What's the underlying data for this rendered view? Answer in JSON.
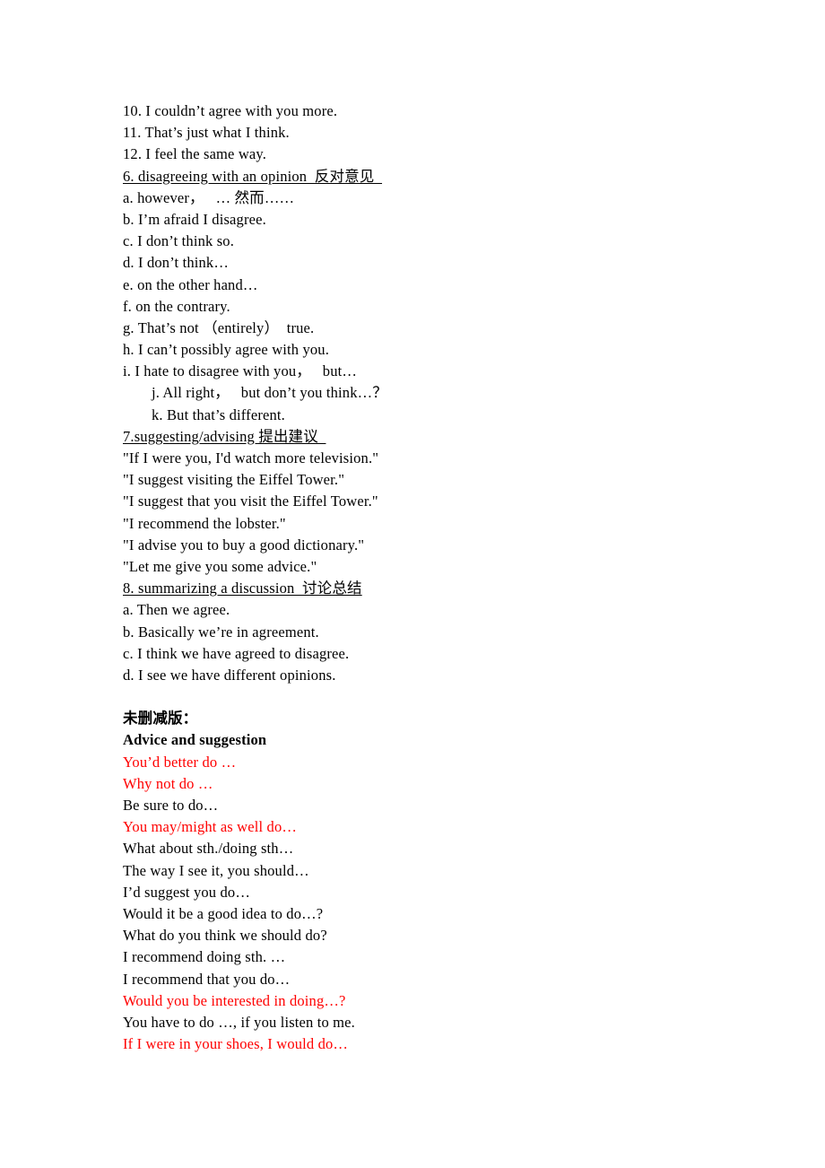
{
  "document": {
    "title": "English Functional Expressions",
    "colors": {
      "text": "#000000",
      "highlight": "#FF0000",
      "background": "#ffffff"
    },
    "blocks": [
      {
        "id": "agreeing-tail",
        "lines": [
          {
            "text": "10. I couldn’t agree with you more.",
            "style": "plain"
          },
          {
            "text": "11. That’s just what I think.",
            "style": "plain"
          },
          {
            "text": "12. I feel the same way.",
            "style": "plain"
          }
        ]
      },
      {
        "id": "section-6-disagreeing",
        "heading": {
          "text": "6. disagreeing with an opinion  反对意见  ",
          "style": "heading"
        },
        "lines": [
          {
            "text": "a. however，   … 然而……",
            "style": "plain"
          },
          {
            "text": "b. I’m afraid I disagree.",
            "style": "plain"
          },
          {
            "text": "c. I don’t think so.",
            "style": "plain"
          },
          {
            "text": "d. I don’t think…",
            "style": "plain"
          },
          {
            "text": "e. on the other hand…",
            "style": "plain"
          },
          {
            "text": "f. on the contrary.",
            "style": "plain"
          },
          {
            "text": "g. That’s not （entirely）  true.",
            "style": "plain"
          },
          {
            "text": "h. I can’t possibly agree with you.",
            "style": "plain"
          },
          {
            "text": "i. I hate to disagree with you，   but…",
            "style": "plain"
          },
          {
            "text": "j. All right，   but don’t you think…？",
            "style": "indent"
          },
          {
            "text": "k. But that’s different.",
            "style": "indent"
          }
        ]
      },
      {
        "id": "section-7-suggesting",
        "heading": {
          "text": "7.suggesting/advising 提出建议  ",
          "style": "heading"
        },
        "lines": [
          {
            "text": "\"If I were you, I'd watch more television.\"",
            "style": "plain"
          },
          {
            "text": "\"I suggest visiting the Eiffel Tower.\"",
            "style": "plain"
          },
          {
            "text": "\"I suggest that you visit the Eiffel Tower.\"",
            "style": "plain"
          },
          {
            "text": "\"I recommend the lobster.\"",
            "style": "plain"
          },
          {
            "text": "\"I advise you to buy a good dictionary.\"",
            "style": "plain"
          },
          {
            "text": "\"Let me give you some advice.\"",
            "style": "plain"
          }
        ]
      },
      {
        "id": "section-8-summarizing",
        "heading": {
          "text": "8. summarizing a discussion  讨论总结",
          "style": "heading"
        },
        "lines": [
          {
            "text": "a. Then we agree.",
            "style": "plain"
          },
          {
            "text": "b. Basically we’re in agreement.",
            "style": "plain"
          },
          {
            "text": "c. I think we have agreed to disagree.",
            "style": "plain"
          },
          {
            "text": "d. I see we have different opinions.",
            "style": "plain"
          }
        ]
      },
      {
        "id": "uncut-version",
        "gap_before": true,
        "lines": [
          {
            "text": "未删减版：",
            "style": "bold"
          },
          {
            "text": "Advice and suggestion",
            "style": "bold"
          },
          {
            "text": "You’d better do …",
            "style": "red"
          },
          {
            "text": "Why not do …",
            "style": "red"
          },
          {
            "text": "Be sure to do…",
            "style": "plain"
          },
          {
            "text": "You may/might as well do…",
            "style": "red"
          },
          {
            "text": "What about sth./doing sth…",
            "style": "plain"
          },
          {
            "text": "The way I see it, you should…",
            "style": "plain"
          },
          {
            "text": "I’d suggest you do…",
            "style": "plain"
          },
          {
            "text": "Would it be a good idea to do…?",
            "style": "plain"
          },
          {
            "text": "What do you think we should do?",
            "style": "plain"
          },
          {
            "text": "I recommend doing sth. …",
            "style": "plain"
          },
          {
            "text": "I recommend that you do…",
            "style": "plain"
          },
          {
            "text": "Would you be interested in doing…?",
            "style": "red"
          },
          {
            "text": "You have to do …, if you listen to me.",
            "style": "plain"
          },
          {
            "text": "If I were in your shoes, I would do…",
            "style": "red"
          }
        ]
      }
    ]
  }
}
